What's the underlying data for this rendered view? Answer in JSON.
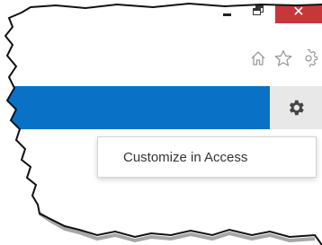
{
  "window": {
    "minimize_icon": "minimize-icon",
    "restore_icon": "restore-icon",
    "close_label": "✕",
    "close_color": "#c7373a"
  },
  "browser": {
    "icons": [
      "home-icon",
      "favorites-star-icon",
      "settings-gear-icon"
    ]
  },
  "app_bar": {
    "color": "#0a72c6",
    "settings_icon": "gear-icon"
  },
  "menu": {
    "items": [
      {
        "label": "Customize in Access"
      }
    ]
  }
}
